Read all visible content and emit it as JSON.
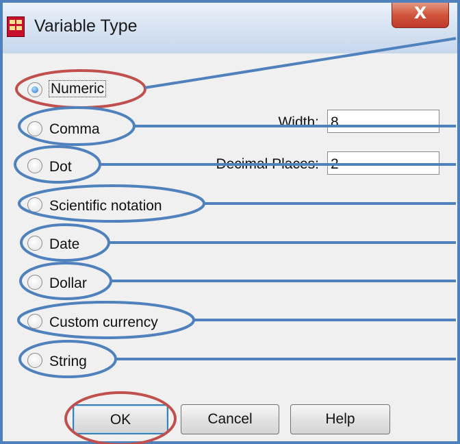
{
  "window": {
    "title": "Variable Type",
    "close_glyph": "X"
  },
  "radio_options": [
    {
      "id": "numeric",
      "label": "Numeric",
      "selected": true
    },
    {
      "id": "comma",
      "label": "Comma",
      "selected": false
    },
    {
      "id": "dot",
      "label": "Dot",
      "selected": false
    },
    {
      "id": "scientific",
      "label": "Scientific notation",
      "selected": false
    },
    {
      "id": "date",
      "label": "Date",
      "selected": false
    },
    {
      "id": "dollar",
      "label": "Dollar",
      "selected": false
    },
    {
      "id": "custom",
      "label": "Custom currency",
      "selected": false
    },
    {
      "id": "string",
      "label": "String",
      "selected": false
    }
  ],
  "fields": {
    "width": {
      "label": "Width:",
      "value": "8"
    },
    "decimal_places": {
      "label": "Decimal Places:",
      "value": "2"
    }
  },
  "buttons": {
    "ok": "OK",
    "cancel": "Cancel",
    "help": "Help"
  },
  "annotation_colors": {
    "highlight": "#c0504d",
    "callout": "#4f81bd"
  }
}
